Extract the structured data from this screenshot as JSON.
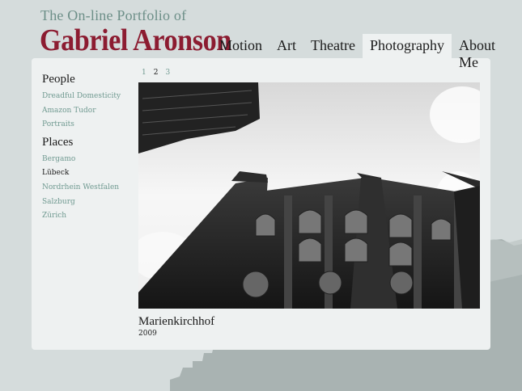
{
  "header": {
    "tagline": "The On-line Portfolio of",
    "site_name": "Gabriel Aronson"
  },
  "nav": {
    "items": [
      {
        "label": "Motion"
      },
      {
        "label": "Art"
      },
      {
        "label": "Theatre"
      },
      {
        "label": "Photography",
        "active": true
      },
      {
        "label": "About Me"
      }
    ]
  },
  "sidebar": {
    "people_heading": "People",
    "people": [
      "Dreadful Domesticity",
      "Amazon Tudor",
      "Portraits"
    ],
    "places_heading": "Places",
    "places": [
      "Bergamo",
      "Lübeck",
      "Nordrhein Westfalen",
      "Salzburg",
      "Zürich"
    ],
    "current_place": "Lübeck"
  },
  "pager": {
    "pages": [
      "1",
      "2",
      "3"
    ],
    "current": "2"
  },
  "photo": {
    "title": "Marienkirchhof",
    "year": "2009"
  },
  "colors": {
    "background": "#d5dcdc",
    "panel": "#eef1f1",
    "brand": "#8c1c31",
    "link": "#6f9990"
  }
}
